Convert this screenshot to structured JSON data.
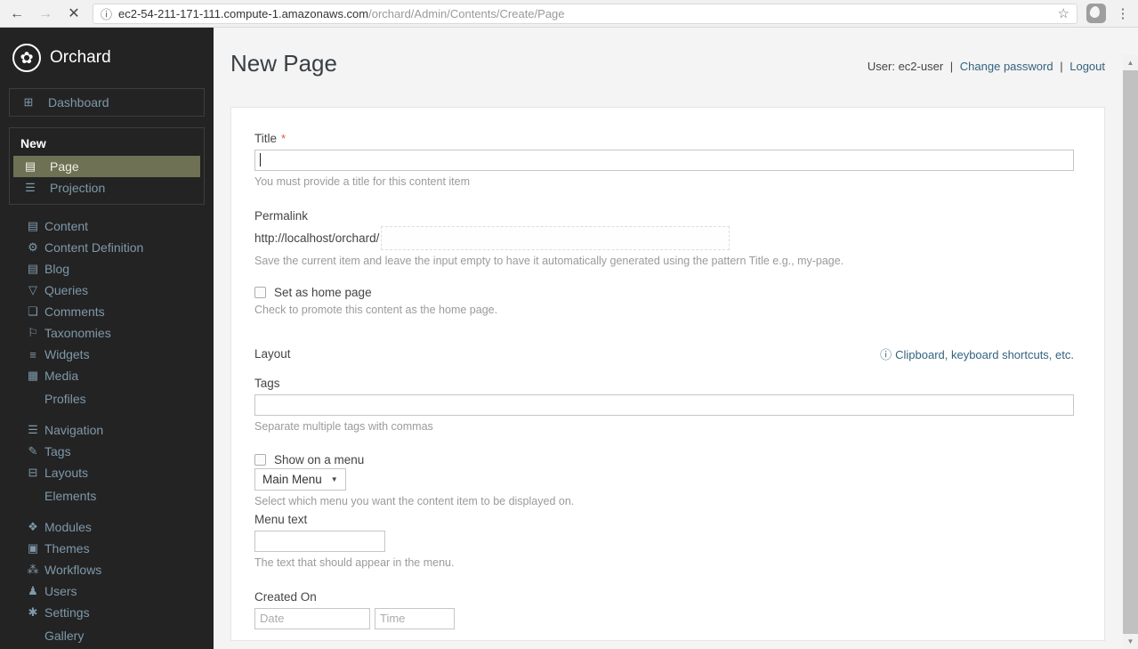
{
  "browser": {
    "url_host": "ec2-54-211-171-111.compute-1.amazonaws.com",
    "url_path": "/orchard/Admin/Contents/Create/Page",
    "back_glyph": "←",
    "forward_glyph": "→",
    "stop_glyph": "✕",
    "info_glyph": "ⓘ",
    "star_glyph": "☆",
    "menu_glyph": "⋮"
  },
  "sidebar": {
    "brand": "Orchard",
    "logo_glyph": "✿",
    "dashboard": {
      "label": "Dashboard",
      "icon": "dashboard"
    },
    "new_section": {
      "title": "New",
      "items": [
        {
          "label": "Page",
          "icon": "page",
          "active": true
        },
        {
          "label": "Projection",
          "icon": "projection",
          "active": false
        }
      ]
    },
    "groups": [
      {
        "items": [
          {
            "label": "Content",
            "icon": "content"
          },
          {
            "label": "Content Definition",
            "icon": "content-definition"
          },
          {
            "label": "Blog",
            "icon": "blog"
          },
          {
            "label": "Queries",
            "icon": "queries"
          },
          {
            "label": "Comments",
            "icon": "comments"
          },
          {
            "label": "Taxonomies",
            "icon": "taxonomies"
          },
          {
            "label": "Widgets",
            "icon": "widgets"
          },
          {
            "label": "Media",
            "icon": "media"
          },
          {
            "label": "Profiles",
            "icon": null
          }
        ]
      },
      {
        "items": [
          {
            "label": "Navigation",
            "icon": "navigation"
          },
          {
            "label": "Tags",
            "icon": "tags"
          },
          {
            "label": "Layouts",
            "icon": "layouts"
          },
          {
            "label": "Elements",
            "icon": null
          }
        ]
      },
      {
        "items": [
          {
            "label": "Modules",
            "icon": "modules"
          },
          {
            "label": "Themes",
            "icon": "themes"
          },
          {
            "label": "Workflows",
            "icon": "workflows"
          },
          {
            "label": "Users",
            "icon": "users"
          },
          {
            "label": "Settings",
            "icon": "settings"
          },
          {
            "label": "Gallery",
            "icon": null
          }
        ]
      }
    ],
    "icon_glyphs": {
      "dashboard": "⊞",
      "page": "▤",
      "projection": "☰",
      "content": "▤",
      "content-definition": "⚙",
      "blog": "▤",
      "queries": "▽",
      "comments": "❏",
      "taxonomies": "⚐",
      "widgets": "≡",
      "media": "▦",
      "navigation": "☰",
      "tags": "✎",
      "layouts": "⊟",
      "modules": "❖",
      "themes": "▣",
      "workflows": "⁂",
      "users": "♟",
      "settings": "✱"
    }
  },
  "header": {
    "title": "New Page",
    "user_label": "User: ec2-user",
    "separator": "|",
    "links": [
      "Change password",
      "Logout"
    ]
  },
  "form": {
    "title_field": {
      "label": "Title",
      "required_mark": "*",
      "value": "",
      "hint": "You must provide a title for this content item"
    },
    "permalink": {
      "label": "Permalink",
      "prefix": "http://localhost/orchard/",
      "value": "",
      "hint": "Save the current item and leave the input empty to have it automatically generated using the pattern Title e.g., my-page."
    },
    "home_page": {
      "label": "Set as home page",
      "checked": false,
      "hint": "Check to promote this content as the home page."
    },
    "layout": {
      "label": "Layout",
      "link_icon_glyph": "ⓘ",
      "link": "Clipboard, keyboard shortcuts, etc."
    },
    "tags": {
      "label": "Tags",
      "value": "",
      "hint": "Separate multiple tags with commas"
    },
    "menu": {
      "checkbox_label": "Show on a menu",
      "checked": false,
      "select_value": "Main Menu",
      "select_caret": "▼",
      "select_hint": "Select which menu you want the content item to be displayed on.",
      "text_label": "Menu text",
      "text_value": "",
      "text_hint": "The text that should appear in the menu."
    },
    "created_on": {
      "label": "Created On",
      "date_placeholder": "Date",
      "time_placeholder": "Time"
    }
  },
  "scrollbar": {
    "up_glyph": "▲",
    "down_glyph": "▼"
  },
  "colors": {
    "sidebar_bg": "#232323",
    "sidebar_link": "#7e99aa",
    "active_item_bg": "#6e7153",
    "link_blue": "#33627e",
    "required_red": "#e0524d",
    "main_bg": "#f4f4f4",
    "card_bg": "#ffffff"
  }
}
